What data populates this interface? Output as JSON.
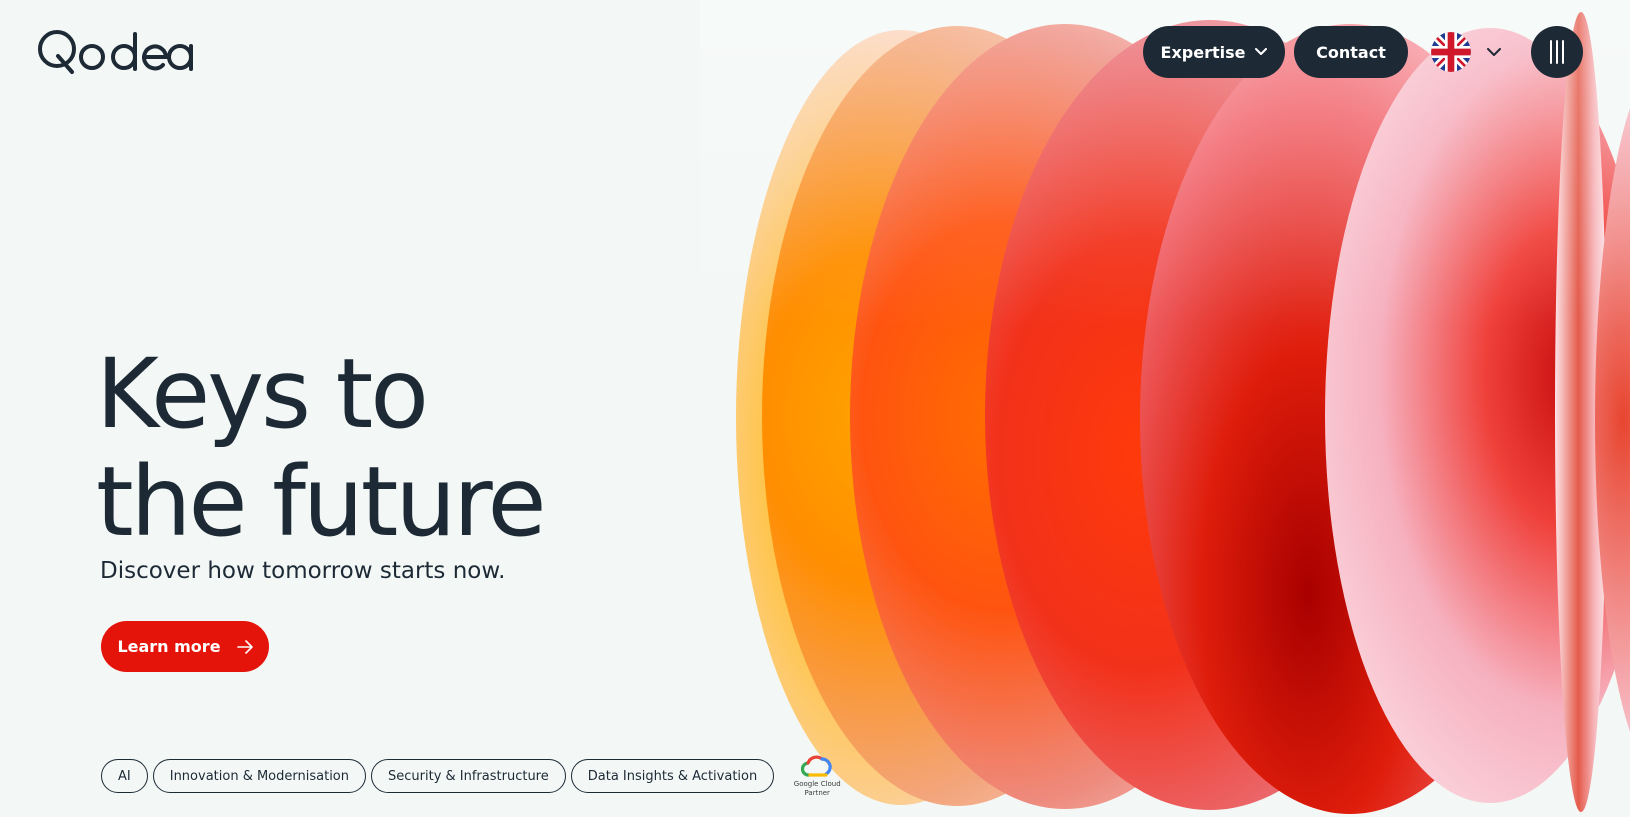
{
  "brand": {
    "logo_text": "Qodea"
  },
  "header": {
    "expertise_label": "Expertise",
    "contact_label": "Contact",
    "language": "en-GB"
  },
  "hero": {
    "headline_line1": "Keys to",
    "headline_line2": "the future",
    "subheadline": "Discover how tomorrow starts now.",
    "cta_label": "Learn more"
  },
  "tags": [
    {
      "label": "AI"
    },
    {
      "label": "Innovation & Modernisation"
    },
    {
      "label": "Security & Infrastructure"
    },
    {
      "label": "Data Insights & Activation"
    }
  ],
  "partner_badge": {
    "line1": "Google Cloud",
    "line2": "Partner"
  },
  "icons": {
    "expertise": "chevron-down-icon",
    "language": "uk-flag-icon",
    "language_toggle": "chevron-down-icon",
    "menu": "menu-bars-icon",
    "cta": "arrow-right-icon",
    "partner": "google-cloud-icon"
  },
  "colors": {
    "background": "#f3f8f6",
    "text": "#1d2a36",
    "primary_dark": "#1d2a36",
    "accent_red": "#e5140b",
    "white": "#ffffff"
  }
}
